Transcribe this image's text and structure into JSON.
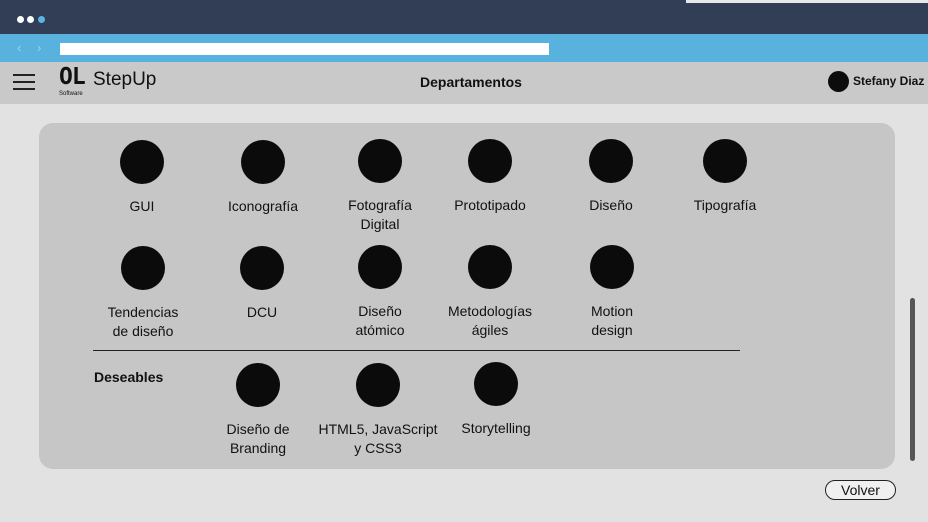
{
  "header": {
    "logo_mark": "OL",
    "logo_sub": "Software",
    "app_name": "StepUp",
    "page_title": "Departamentos",
    "user_name": "Stefany Diaz"
  },
  "departments": [
    {
      "label": "GUI"
    },
    {
      "label": "Iconografía"
    },
    {
      "label": "Fotografía\nDigital"
    },
    {
      "label": "Prototipado"
    },
    {
      "label": "Diseño"
    },
    {
      "label": "Tipografía"
    },
    {
      "label": "Tendencias\nde diseño"
    },
    {
      "label": "DCU"
    },
    {
      "label": "Diseño\natómico"
    },
    {
      "label": "Metodologías\nágiles"
    },
    {
      "label": "Motion\ndesign"
    }
  ],
  "desirables": {
    "section_label": "Deseables",
    "items": [
      {
        "label": "Diseño de\nBranding"
      },
      {
        "label": "HTML5, JavaScript\ny CSS3"
      },
      {
        "label": "Storytelling"
      }
    ]
  },
  "footer": {
    "back_label": "Volver"
  },
  "icons": {
    "menu": "hamburger-menu-icon",
    "back": "chevron-left-icon",
    "forward": "chevron-right-icon"
  }
}
